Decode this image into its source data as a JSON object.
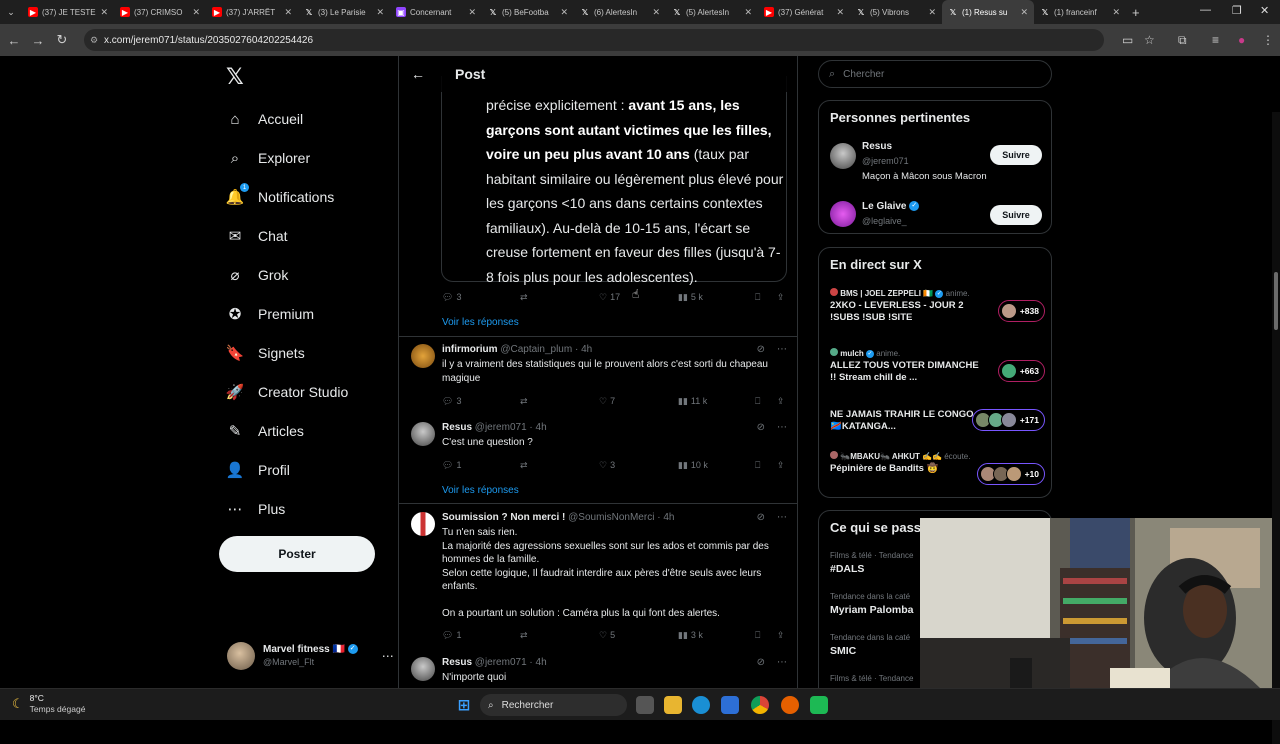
{
  "browser": {
    "tabs": [
      {
        "title": "(37) JE TESTE",
        "icon": "youtube-icon",
        "active": false
      },
      {
        "title": "(37) CRIMSO",
        "icon": "youtube-icon",
        "active": false
      },
      {
        "title": "(37) J'ARRÊT",
        "icon": "youtube-icon",
        "active": false
      },
      {
        "title": "(3) Le Parisie",
        "icon": "x-icon",
        "active": false
      },
      {
        "title": "Concernant",
        "icon": "twitch-icon",
        "active": false
      },
      {
        "title": "(5) BeFootba",
        "icon": "x-icon",
        "active": false
      },
      {
        "title": "(6) AlertesIn",
        "icon": "x-icon",
        "active": false
      },
      {
        "title": "(5) AlertesIn",
        "icon": "x-icon",
        "active": false
      },
      {
        "title": "(37) Générat",
        "icon": "youtube-icon",
        "active": false
      },
      {
        "title": "(5) Vibrons",
        "icon": "x-icon",
        "active": false
      },
      {
        "title": "(1) Resus su",
        "icon": "x-icon",
        "active": true
      },
      {
        "title": "(1) franceinf",
        "icon": "x-icon",
        "active": false
      }
    ],
    "url": "x.com/jerem071/status/2035027604202254426"
  },
  "nav": {
    "logo": "𝕏",
    "items": [
      {
        "label": "Accueil",
        "icon": "home-icon",
        "glyph": "⌂"
      },
      {
        "label": "Explorer",
        "icon": "search-icon",
        "glyph": "⌕"
      },
      {
        "label": "Notifications",
        "icon": "bell-icon",
        "glyph": "🔔",
        "badge": "1"
      },
      {
        "label": "Chat",
        "icon": "mail-icon",
        "glyph": "✉"
      },
      {
        "label": "Grok",
        "icon": "grok-icon",
        "glyph": "⌀"
      },
      {
        "label": "Premium",
        "icon": "premium-icon",
        "glyph": "✪"
      },
      {
        "label": "Signets",
        "icon": "bookmark-icon",
        "glyph": "🔖"
      },
      {
        "label": "Creator Studio",
        "icon": "rocket-icon",
        "glyph": "🚀"
      },
      {
        "label": "Articles",
        "icon": "article-icon",
        "glyph": "✎"
      },
      {
        "label": "Profil",
        "icon": "person-icon",
        "glyph": "👤"
      },
      {
        "label": "Plus",
        "icon": "more-icon",
        "glyph": "⋯"
      }
    ],
    "post_button": "Poster",
    "account": {
      "name": "Marvel fitness 🇫🇷",
      "handle": "@Marvel_Flt"
    }
  },
  "center": {
    "header": "Post",
    "quote_lines": [
      {
        "bold": false,
        "text": "précise explicitement : "
      },
      {
        "bold": true,
        "text": "avant 15 ans, les garçons sont autant victimes que les filles, voire un peu plus avant 10 ans"
      },
      {
        "bold": false,
        "text": " (taux par habitant similaire ou légèrement plus élevé pour les garçons <10 ans dans certains contextes familiaux). Au-delà de 10-15 ans, l'écart se creuse fortement en faveur des filles (jusqu'à 7-8 fois plus pour les adolescentes)."
      }
    ],
    "quote_part1": "précise explicitement : ",
    "quote_part2": "avant 15 ans, les garçons sont autant victimes que les filles, voire un peu plus avant 10 ans",
    "quote_part3": " (taux par habitant similaire ou légèrement plus élevé pour les garçons <10 ans dans certains contextes familiaux). Au-delà de 10-15 ans, l'écart se creuse fortement en faveur des filles (jusqu'à 7-8 fois plus pour les adolescentes).",
    "main_actions": {
      "replies": "3",
      "reposts": "",
      "likes": "17",
      "views": "5 k"
    },
    "show_replies": "Voir les réponses",
    "tweets": [
      {
        "name": "infirmorium",
        "handle": "@Captain_plum",
        "time": "· 4h",
        "text": "il y a vraiment des statistiques qui le prouvent alors c'est sorti du chapeau magique",
        "replies": "3",
        "likes": "7",
        "views": "11 k"
      },
      {
        "name": "Resus",
        "handle": "@jerem071",
        "time": "· 4h",
        "text": "C'est une question ?",
        "replies": "1",
        "likes": "3",
        "views": "10 k"
      },
      {
        "name": "Soumission ? Non merci !",
        "handle": "@SoumisNonMerci",
        "time": "· 4h",
        "text_lines": [
          "Tu n'en sais rien.",
          "La majorité des agressions sexuelles sont sur les ados et commis par des hommes de la famille.",
          "Selon cette logique, Il faudrait interdire aux pères d'être seuls avec leurs enfants.",
          "",
          "On a pourtant un solution : Caméra plus la qui font des alertes."
        ],
        "replies": "1",
        "likes": "5",
        "views": "3 k"
      },
      {
        "name": "Resus",
        "handle": "@jerem071",
        "time": "· 4h",
        "text": "N'importe quoi"
      }
    ]
  },
  "right": {
    "search_placeholder": "Chercher",
    "relevant": {
      "title": "Personnes pertinentes",
      "people": [
        {
          "name": "Resus",
          "handle": "@jerem071",
          "bio": "Maçon à Mâcon sous Macron",
          "follow": "Suivre"
        },
        {
          "name": "Le Glaive",
          "handle": "@leglaive_",
          "bio": "",
          "follow": "Suivre"
        }
      ]
    },
    "live": {
      "title": "En direct sur X",
      "items": [
        {
          "host": "BMS | JOEL ZEPPELI 🇨🇮",
          "status": "anime.",
          "title": "2XKO - LEVERLESS - JOUR 2 !SUBS !SUB !SITE",
          "count": "+838"
        },
        {
          "host": "mulch",
          "status": "anime.",
          "title": "ALLEZ TOUS VOTER DIMANCHE !! Stream chill de ...",
          "count": "+663"
        },
        {
          "host": "",
          "status": "",
          "title": "NE JAMAIS TRAHIR LE CONGO 🇨🇩KATANGA...",
          "count": "+171"
        },
        {
          "host": "🐜MBAKU🐜 AHKUT ✍️✍️",
          "status": "écoute.",
          "title": "Pépinière de Bandits 🤠",
          "count": "+10"
        }
      ]
    },
    "trends": {
      "title": "Ce qui se passe",
      "items": [
        {
          "category": "Films & télé · Tendance",
          "name": "#DALS"
        },
        {
          "category": "Tendance dans la caté",
          "name": "Myriam Palomba"
        },
        {
          "category": "Tendance dans la caté",
          "name": "SMIC"
        },
        {
          "category": "Films & télé · Tendance",
          "name": ""
        }
      ]
    }
  },
  "taskbar": {
    "temperature": "8°C",
    "weather": "Temps dégagé",
    "search": "Rechercher"
  }
}
